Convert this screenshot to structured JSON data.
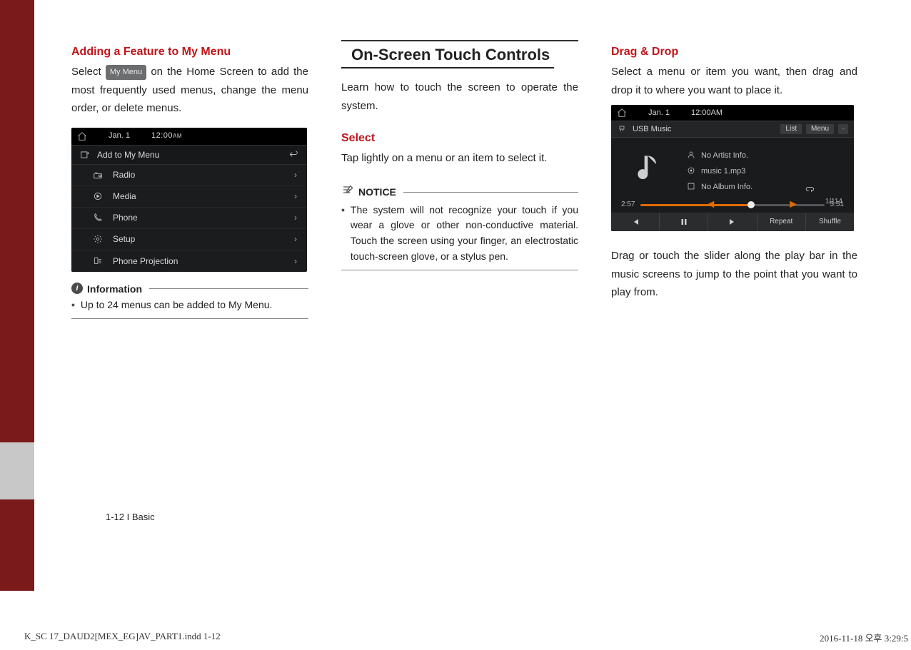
{
  "col1": {
    "heading": "Adding a Feature to My Menu",
    "body_pre": "Select ",
    "chip": "My Menu",
    "body_post": " on the Home Screen to add the most frequently used menus, change the menu order, or delete menus.",
    "shot": {
      "date": "Jan. 1",
      "time": "12:00",
      "ampm": "AM",
      "subtitle": "Add to My Menu",
      "rows": [
        {
          "label": "Radio"
        },
        {
          "label": "Media"
        },
        {
          "label": "Phone"
        },
        {
          "label": "Setup"
        },
        {
          "label": "Phone Projection"
        }
      ]
    },
    "info_label": "Information",
    "info_bullet": "Up to 24 menus can be added to My Menu."
  },
  "col2": {
    "section_title": "On-Screen Touch Controls",
    "intro": "Learn how to touch the screen to operate the system.",
    "select_head": "Select",
    "select_body": "Tap lightly on a menu or an item to select it.",
    "notice_label": "NOTICE",
    "notice_bullet": "The system will not recognize your touch if you wear a glove or other non-conductive material. Touch the screen using your finger, an electrostatic touch-screen glove, or a stylus pen."
  },
  "col3": {
    "heading": "Drag & Drop",
    "body": "Select a menu or item you want, then drag and drop it to where you want to place it.",
    "shot": {
      "date": "Jan. 1",
      "time": "12:00",
      "ampm": "AM",
      "source": "USB Music",
      "btn_list": "List",
      "btn_menu": "Menu",
      "artist": "No Artist Info.",
      "track": "music 1.mp3",
      "album": "No Album Info.",
      "elapsed": "2:57",
      "total": "5:51",
      "count": "1/114",
      "ctrl_repeat": "Repeat",
      "ctrl_shuffle": "Shuffle"
    },
    "tail": "Drag or touch the slider along the play bar in the music screens to jump to the point that you want to play from."
  },
  "footer": {
    "page": "1-12 I Basic",
    "indd": "K_SC 17_DAUD2[MEX_EG]AV_PART1.indd   1-12",
    "stamp": "2016-11-18   오후 3:29:5"
  }
}
